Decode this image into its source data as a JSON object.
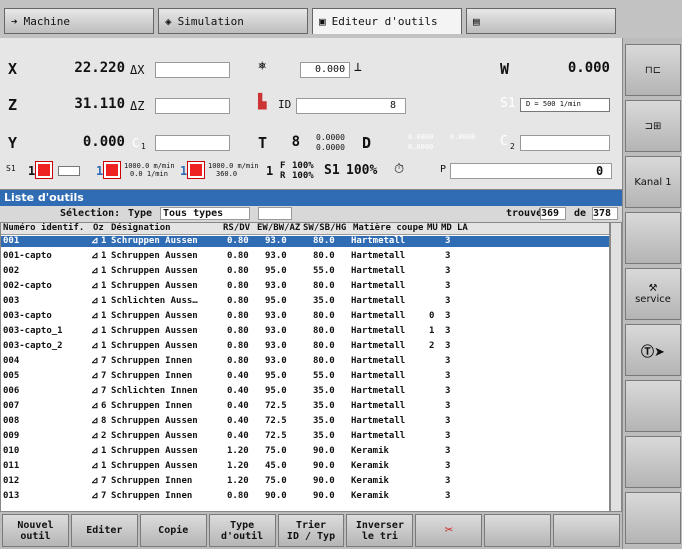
{
  "tabs": [
    {
      "label": "Machine",
      "icon": "machine-arrow-icon"
    },
    {
      "label": "Simulation",
      "icon": "simulation-icon"
    },
    {
      "label": "Editeur d'outils",
      "icon": "tool-editor-icon"
    },
    {
      "label": "",
      "icon": "program-icon"
    }
  ],
  "machine": {
    "x": {
      "axis": "X",
      "value": "22.220",
      "delta": "ΔX"
    },
    "z": {
      "axis": "Z",
      "value": "31.110",
      "delta": "ΔZ"
    },
    "y": {
      "axis": "Y",
      "value": "0.000",
      "c": "C",
      "c_sub": "1"
    },
    "w": {
      "axis": "W",
      "value": "0.000"
    },
    "s1": {
      "label": "S1",
      "value": "D = 500 1/min",
      "sub": "0%"
    },
    "feed_display": "0.000",
    "id_label": "ID",
    "id_value": "8",
    "t_label": "T",
    "t_value": "8",
    "tool_xz": {
      "x": "0.0000",
      "z": "0.0000"
    },
    "d_label": "D",
    "d_xz": {
      "x": "0.0000",
      "y": "0.0000",
      "z": "0.0000"
    },
    "c2": "C",
    "c2_sub": "2",
    "status_row": {
      "s1": "S1",
      "one": "1",
      "speed1": "1000.0 m/min",
      "speed1b": "0.0 1/min",
      "speed2": "1000.0 m/min",
      "speed2b": "360.0",
      "f_label": "F",
      "r_label": "R",
      "f_val": "100%",
      "r_val": "100%",
      "s1_pct_label": "S1",
      "s1_pct": "100%",
      "p_label": "P",
      "p_value": "0"
    }
  },
  "list": {
    "title": "Liste d'outils",
    "filter_label": "Sélection:",
    "filter_type_label": "Type",
    "filter_type_value": "Tous types",
    "found_label": "trouvé",
    "found_value": "369",
    "of_label": "de",
    "of_value": "378",
    "columns": [
      "Numéro identif.",
      "Oz",
      "Désignation",
      "RS/DV",
      "EW/BW/AZ",
      "SW/SB/HG",
      "Matière coupe",
      "MU",
      "MD",
      "LA"
    ],
    "rows": [
      {
        "id": "001",
        "oz": "1",
        "des": "Schruppen Aussen",
        "rs": "0.80",
        "ew": "93.0",
        "sw": "80.0",
        "mat": "Hartmetall",
        "mu": "",
        "md": "3",
        "sel": true
      },
      {
        "id": "001-capto",
        "oz": "1",
        "des": "Schruppen Aussen",
        "rs": "0.80",
        "ew": "93.0",
        "sw": "80.0",
        "mat": "Hartmetall",
        "mu": "",
        "md": "3"
      },
      {
        "id": "002",
        "oz": "1",
        "des": "Schruppen Aussen",
        "rs": "0.80",
        "ew": "95.0",
        "sw": "55.0",
        "mat": "Hartmetall",
        "mu": "",
        "md": "3"
      },
      {
        "id": "002-capto",
        "oz": "1",
        "des": "Schruppen Aussen",
        "rs": "0.80",
        "ew": "93.0",
        "sw": "80.0",
        "mat": "Hartmetall",
        "mu": "",
        "md": "3"
      },
      {
        "id": "003",
        "oz": "1",
        "des": "Schlichten Auss…",
        "rs": "0.80",
        "ew": "95.0",
        "sw": "35.0",
        "mat": "Hartmetall",
        "mu": "",
        "md": "3"
      },
      {
        "id": "003-capto",
        "oz": "1",
        "des": "Schruppen Aussen",
        "rs": "0.80",
        "ew": "93.0",
        "sw": "80.0",
        "mat": "Hartmetall",
        "mu": "0",
        "md": "3"
      },
      {
        "id": "003-capto_1",
        "oz": "1",
        "des": "Schruppen Aussen",
        "rs": "0.80",
        "ew": "93.0",
        "sw": "80.0",
        "mat": "Hartmetall",
        "mu": "1",
        "md": "3"
      },
      {
        "id": "003-capto_2",
        "oz": "1",
        "des": "Schruppen Aussen",
        "rs": "0.80",
        "ew": "93.0",
        "sw": "80.0",
        "mat": "Hartmetall",
        "mu": "2",
        "md": "3"
      },
      {
        "id": "004",
        "oz": "7",
        "des": "Schruppen Innen",
        "rs": "0.80",
        "ew": "93.0",
        "sw": "80.0",
        "mat": "Hartmetall",
        "mu": "",
        "md": "3"
      },
      {
        "id": "005",
        "oz": "7",
        "des": "Schruppen Innen",
        "rs": "0.40",
        "ew": "95.0",
        "sw": "55.0",
        "mat": "Hartmetall",
        "mu": "",
        "md": "3"
      },
      {
        "id": "006",
        "oz": "7",
        "des": "Schlichten Innen",
        "rs": "0.40",
        "ew": "95.0",
        "sw": "35.0",
        "mat": "Hartmetall",
        "mu": "",
        "md": "3"
      },
      {
        "id": "007",
        "oz": "6",
        "des": "Schruppen Innen",
        "rs": "0.40",
        "ew": "72.5",
        "sw": "35.0",
        "mat": "Hartmetall",
        "mu": "",
        "md": "3"
      },
      {
        "id": "008",
        "oz": "8",
        "des": "Schruppen Aussen",
        "rs": "0.40",
        "ew": "72.5",
        "sw": "35.0",
        "mat": "Hartmetall",
        "mu": "",
        "md": "3"
      },
      {
        "id": "009",
        "oz": "2",
        "des": "Schruppen Aussen",
        "rs": "0.40",
        "ew": "72.5",
        "sw": "35.0",
        "mat": "Hartmetall",
        "mu": "",
        "md": "3"
      },
      {
        "id": "010",
        "oz": "1",
        "des": "Schruppen Aussen",
        "rs": "1.20",
        "ew": "75.0",
        "sw": "90.0",
        "mat": "Keramik",
        "mu": "",
        "md": "3"
      },
      {
        "id": "011",
        "oz": "1",
        "des": "Schruppen Aussen",
        "rs": "1.20",
        "ew": "45.0",
        "sw": "90.0",
        "mat": "Keramik",
        "mu": "",
        "md": "3"
      },
      {
        "id": "012",
        "oz": "7",
        "des": "Schruppen Innen",
        "rs": "1.20",
        "ew": "75.0",
        "sw": "90.0",
        "mat": "Keramik",
        "mu": "",
        "md": "3"
      },
      {
        "id": "013",
        "oz": "7",
        "des": "Schruppen Innen",
        "rs": "0.80",
        "ew": "90.0",
        "sw": "90.0",
        "mat": "Keramik",
        "mu": "",
        "md": "3"
      }
    ]
  },
  "vkeys": [
    {
      "label": "",
      "icon": "tool-holder-icon"
    },
    {
      "label": "",
      "icon": "turret-icon"
    },
    {
      "label": "Kanal 1",
      "icon": ""
    },
    {
      "label": "",
      "icon": ""
    },
    {
      "label": "service",
      "icon": "wrench-service-icon"
    },
    {
      "label": "",
      "icon": "t-arrow-icon"
    },
    {
      "label": "",
      "icon": ""
    },
    {
      "label": "",
      "icon": ""
    },
    {
      "label": "",
      "icon": ""
    }
  ],
  "hkeys": [
    "Nouvel\noutil",
    "Editer",
    "Copie",
    "Type\nd'outil",
    "Trier\nID / Typ",
    "Inverser\nle tri",
    "",
    "",
    ""
  ]
}
